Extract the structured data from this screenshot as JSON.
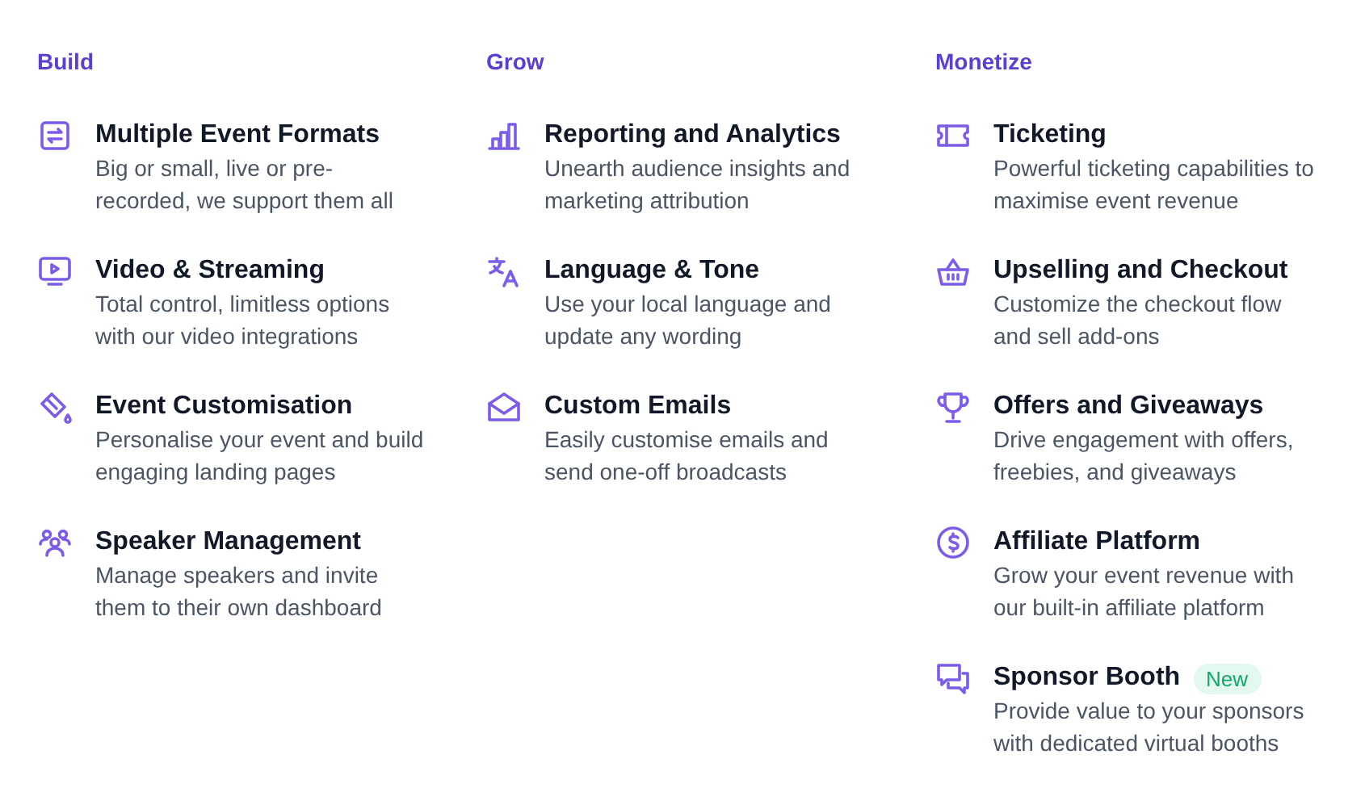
{
  "columns": [
    {
      "heading": "Build",
      "items": [
        {
          "title": "Multiple Event Formats",
          "description": "Big or small, live or pre-recorded, we support them all"
        },
        {
          "title": "Video & Streaming",
          "description": "Total control, limitless options with our video integrations"
        },
        {
          "title": "Event Customisation",
          "description": "Personalise your event and build engaging landing pages"
        },
        {
          "title": "Speaker Management",
          "description": "Manage speakers and invite them to their own dashboard"
        }
      ]
    },
    {
      "heading": "Grow",
      "items": [
        {
          "title": "Reporting and Analytics",
          "description": "Unearth audience insights and marketing attribution"
        },
        {
          "title": "Language & Tone",
          "description": "Use your local language and update any wording"
        },
        {
          "title": "Custom Emails",
          "description": "Easily customise emails and send one-off broadcasts"
        }
      ]
    },
    {
      "heading": "Monetize",
      "items": [
        {
          "title": "Ticketing",
          "description": "Powerful ticketing capabilities to maximise event revenue"
        },
        {
          "title": "Upselling and Checkout",
          "description": "Customize the checkout flow and sell add-ons"
        },
        {
          "title": "Offers and Giveaways",
          "description": "Drive engagement with offers, freebies, and giveaways"
        },
        {
          "title": "Affiliate Platform",
          "description": "Grow your event revenue with our built-in affiliate platform"
        },
        {
          "title": "Sponsor Booth",
          "badge": "New",
          "description": "Provide value to your sponsors with dedicated virtual booths"
        }
      ]
    }
  ]
}
